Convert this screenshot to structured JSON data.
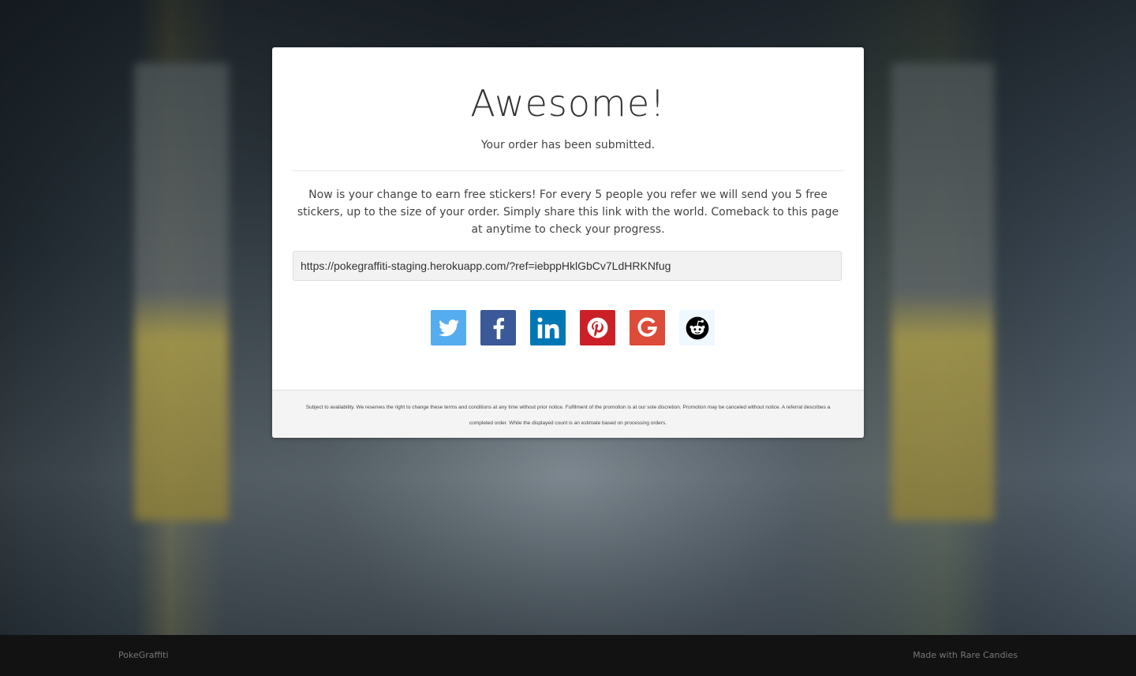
{
  "card": {
    "title": "Awesome!",
    "subtitle": "Your order has been submitted.",
    "description": "Now is your change to earn free stickers! For every 5 people you refer we will send you 5 free stickers, up to the size of your order. Simply share this link with the world. Comeback to this page at anytime to check your progress.",
    "referral_link": "https://pokegraffiti-staging.herokuapp.com/?ref=iebppHklGbCv7LdHRKNfug",
    "fine_print": "Subject to availability. We reserves the right to change these terms and conditions at any time without prior notice. Fulfilment of the promotion is at our sole discretion. Promotion may be canceled without notice. A referral describes a completed order. While the displayed count is an estimate based on processing orders."
  },
  "social": [
    {
      "icon": "twitter-icon",
      "color": "#55acee"
    },
    {
      "icon": "facebook-icon",
      "color": "#3b5998"
    },
    {
      "icon": "linkedin-icon",
      "color": "#0077b5"
    },
    {
      "icon": "pinterest-icon",
      "color": "#cb2027"
    },
    {
      "icon": "google-icon",
      "color": "#dd4b39"
    },
    {
      "icon": "reddit-icon",
      "color": "#eff7ff"
    }
  ],
  "footer": {
    "left": "PokeGraffiti",
    "right": "Made with Rare Candies"
  }
}
